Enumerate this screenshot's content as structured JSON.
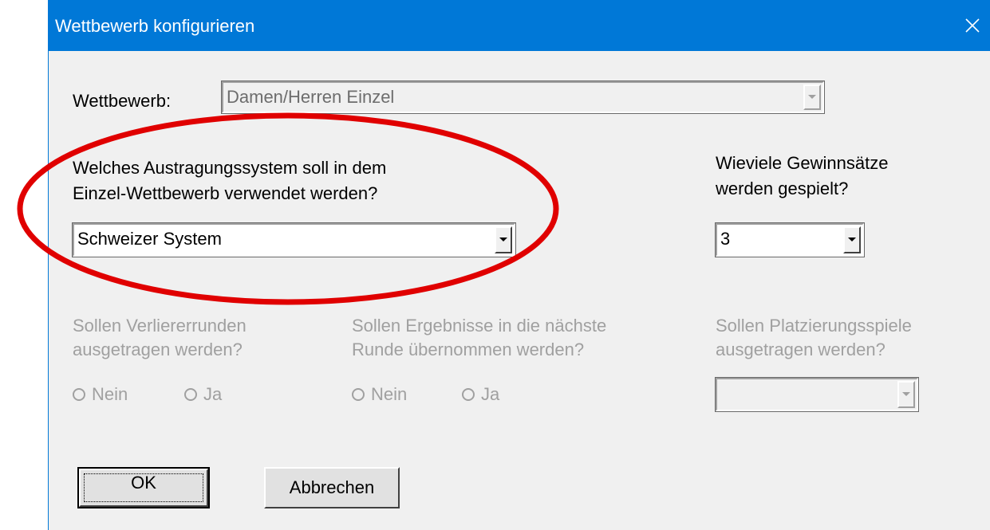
{
  "window": {
    "title": "Wettbewerb konfigurieren",
    "close_glyph": "✕"
  },
  "competition": {
    "label": "Wettbewerb:",
    "value": "Damen/Herren Einzel",
    "enabled": false
  },
  "system": {
    "question_line1": "Welches Austragungssystem soll in dem",
    "question_line2": "Einzel-Wettbewerb verwendet werden?",
    "value": "Schweizer System"
  },
  "sets": {
    "question_line1": "Wieviele Gewinnsätze",
    "question_line2": "werden gespielt?",
    "value": "3"
  },
  "loser_rounds": {
    "question_line1": "Sollen Verliererrunden",
    "question_line2": "ausgetragen werden?",
    "option_no": "Nein",
    "option_yes": "Ja",
    "enabled": false
  },
  "carry_results": {
    "question_line1": "Sollen Ergebnisse in die nächste",
    "question_line2": "Runde übernommen werden?",
    "option_no": "Nein",
    "option_yes": "Ja",
    "enabled": false
  },
  "placement": {
    "question_line1": "Sollen Platzierungsspiele",
    "question_line2": "ausgetragen werden?",
    "value": "",
    "enabled": false
  },
  "buttons": {
    "ok_label": "OK",
    "cancel_label": "Abbrechen"
  },
  "colors": {
    "titlebar": "#0078d7",
    "dialog_bg": "#f0f0f0",
    "disabled_text": "#a0a0a0",
    "annotation": "#e00000"
  },
  "icons": {
    "close": "close-icon",
    "dropdown": "chevron-down-icon"
  }
}
